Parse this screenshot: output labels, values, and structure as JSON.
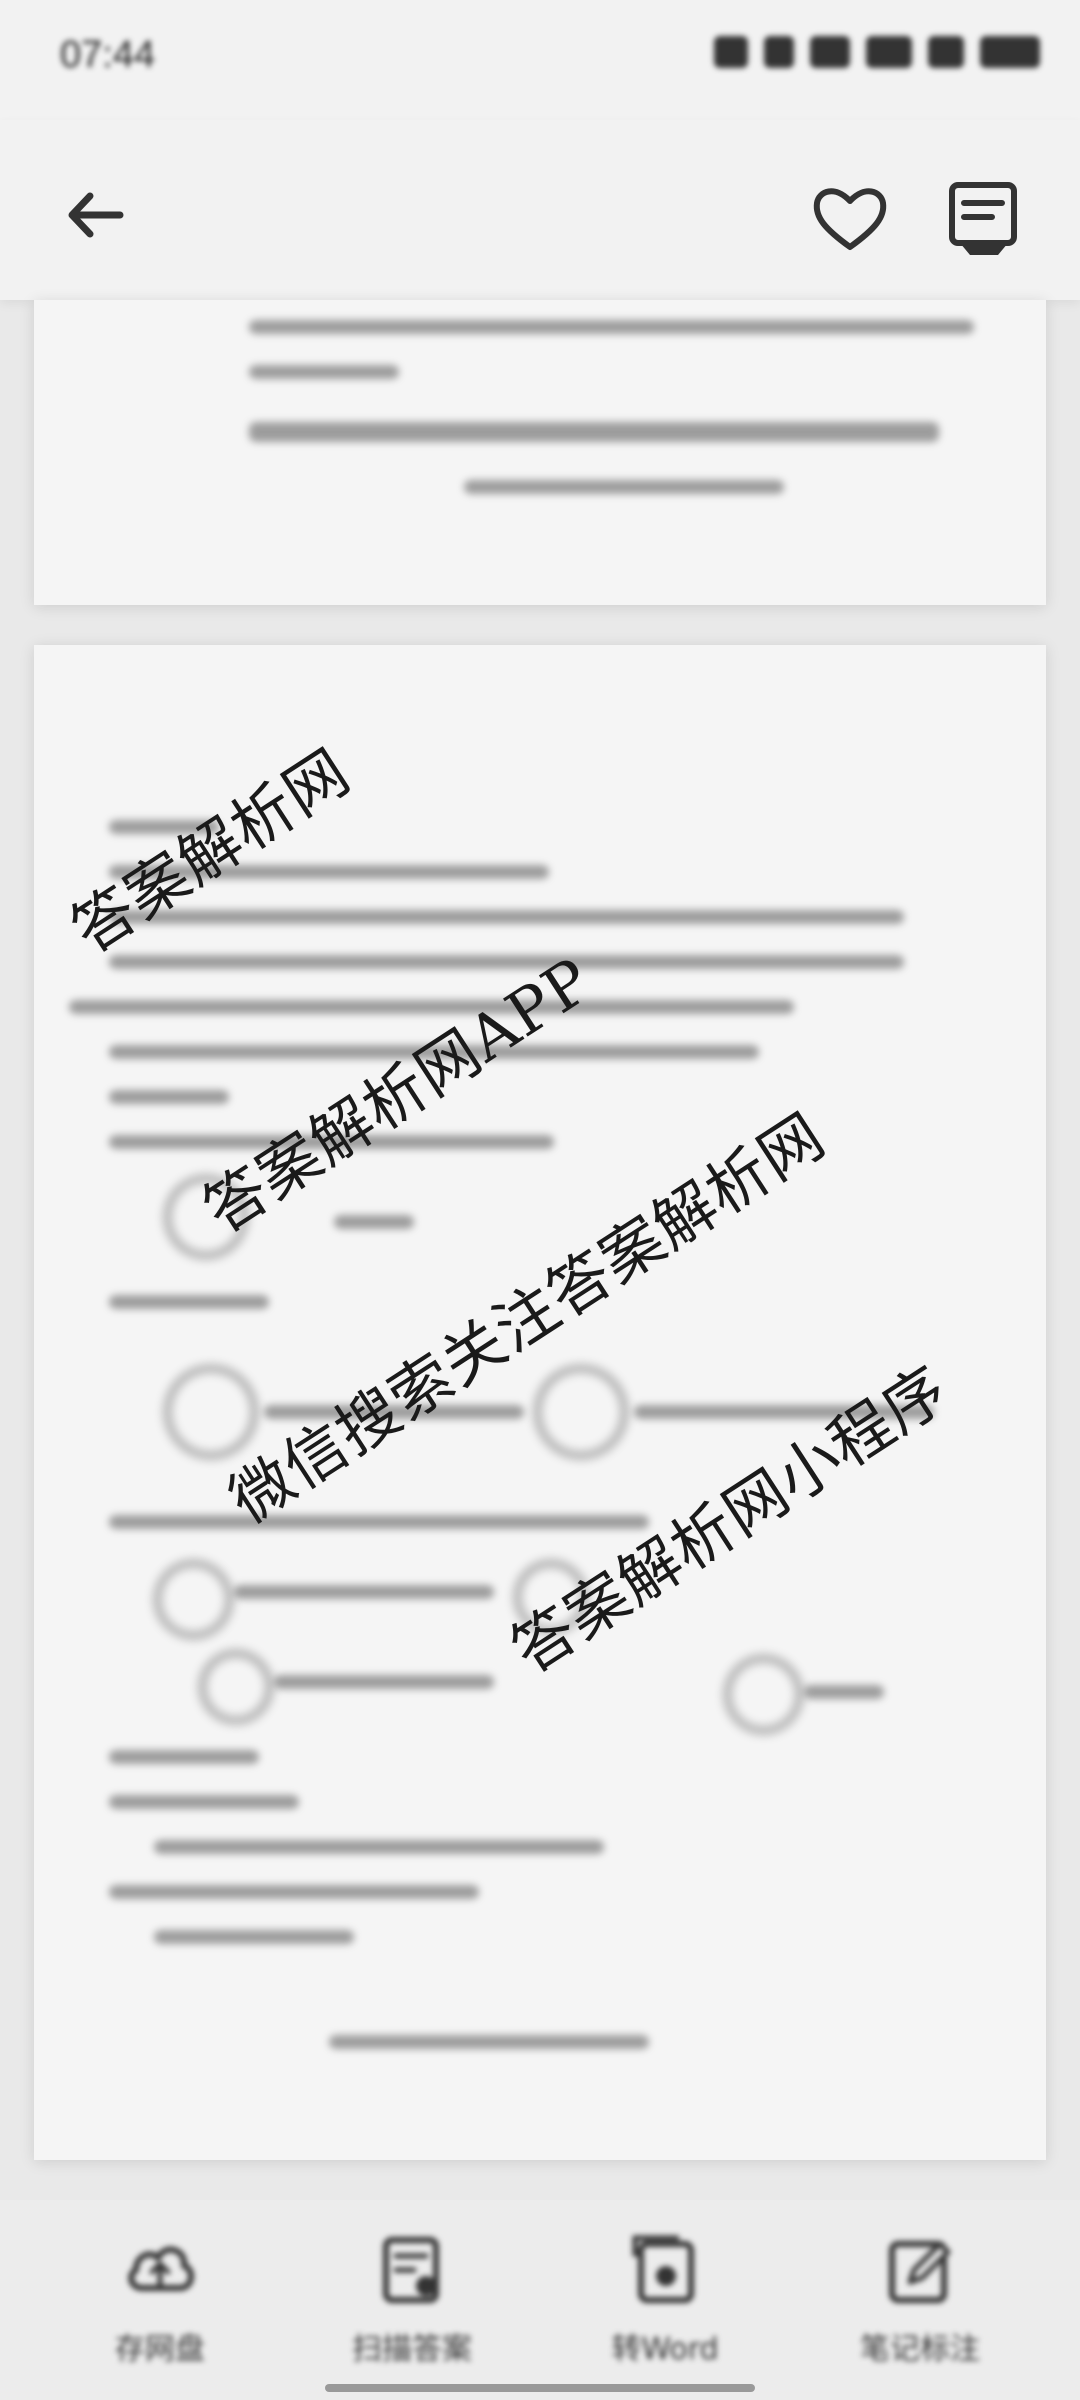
{
  "status_bar": {
    "time": "07:44",
    "icons": [
      "signal-icon",
      "wifi-icon",
      "battery-icon"
    ]
  },
  "app_bar": {
    "icons": [
      "back-arrow-icon",
      "heart-icon",
      "document-list-icon"
    ]
  },
  "watermarks": [
    "答案解析网",
    "答案解析网APP",
    "微信搜索关注答案解析网",
    "答案解析网小程序"
  ],
  "bottom_toolbar": {
    "items": [
      {
        "label": "存网盘",
        "icon": "cloud-upload-icon"
      },
      {
        "label": "扫描答案",
        "icon": "scan-doc-icon"
      },
      {
        "label": "转Word",
        "icon": "convert-word-icon"
      },
      {
        "label": "笔记标注",
        "icon": "edit-note-icon"
      }
    ]
  }
}
